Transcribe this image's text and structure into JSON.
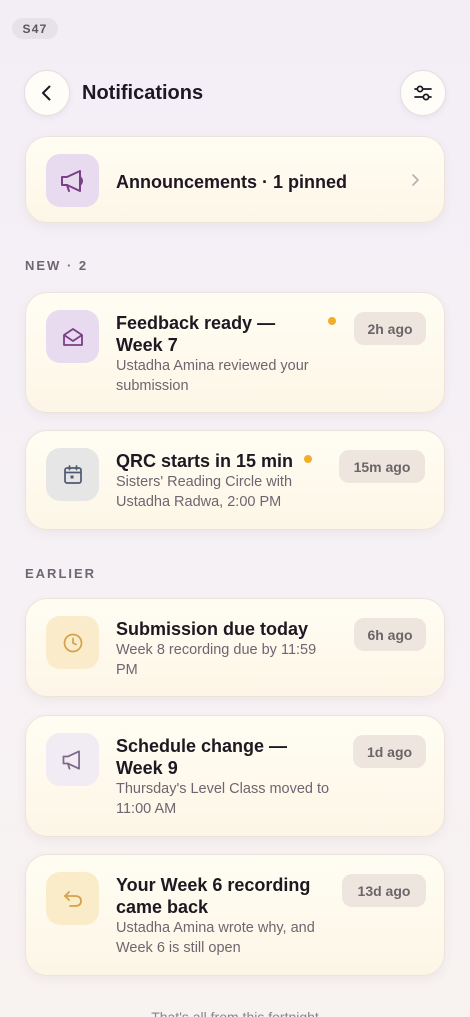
{
  "status": {
    "label": "S47"
  },
  "header": {
    "title": "Notifications"
  },
  "announcements": {
    "label": "Announcements · 1 pinned"
  },
  "sections": {
    "new_label": "NEW · 2",
    "earlier_label": "EARLIER"
  },
  "notifications": [
    {
      "title": "Feedback ready — Week 7",
      "subtitle": "Ustadha Amina reviewed your submission",
      "time": "2h ago",
      "unread": true,
      "icon": "envelope-open-icon"
    },
    {
      "title": "QRC starts in 15 min",
      "subtitle": "Sisters' Reading Circle with Ustadha Radwa, 2:00 PM",
      "time": "15m ago",
      "unread": true,
      "icon": "calendar-icon"
    },
    {
      "title": "Submission due today",
      "subtitle": "Week 8 recording due by 11:59 PM",
      "time": "6h ago",
      "unread": false,
      "icon": "clock-icon"
    },
    {
      "title": "Schedule change — Week 9",
      "subtitle": "Thursday's Level Class moved to 11:00 AM",
      "time": "1d ago",
      "unread": false,
      "icon": "megaphone-icon"
    },
    {
      "title": "Your Week 6 recording came back",
      "subtitle": "Ustadha Amina wrote why, and Week 6 is still open",
      "time": "13d ago",
      "unread": false,
      "icon": "undo-arrow-icon"
    }
  ],
  "footer": {
    "text": "That's all from this fortnight"
  },
  "colors": {
    "accent_dot": "#f2ad2a",
    "purple_icon": "#7a3f86",
    "slate_icon": "#4d5a70",
    "amber_icon": "#d4a24a"
  }
}
